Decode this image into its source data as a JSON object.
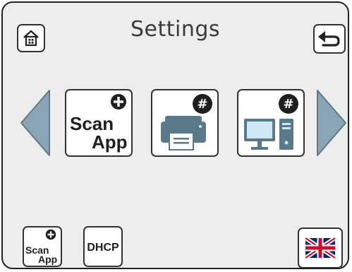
{
  "header": {
    "title": "Settings",
    "home_icon": "home-icon",
    "back_icon": "back-arrow-icon"
  },
  "carousel": {
    "prev_icon": "triangle-left-icon",
    "next_icon": "triangle-right-icon",
    "tiles": [
      {
        "line1": "Scan",
        "line2": "App",
        "badge": "plus-icon"
      },
      {
        "icon": "printer-icon",
        "badge": "hash-icon",
        "badge_text": "#"
      },
      {
        "icon": "computer-icon",
        "badge": "hash-icon",
        "badge_text": "#"
      }
    ]
  },
  "footer": {
    "scan_app": {
      "line1": "Scan",
      "line2": "App",
      "badge": "plus-icon"
    },
    "dhcp_label": "DHCP",
    "language_icon": "uk-flag-icon"
  },
  "colors": {
    "screen_bg": "#ededed",
    "arrow_fill": "#8aa5b5",
    "device_blue": "#5a7a8a",
    "monitor_screen": "#cfe7f2",
    "badge_dark": "#1f1f1f"
  }
}
